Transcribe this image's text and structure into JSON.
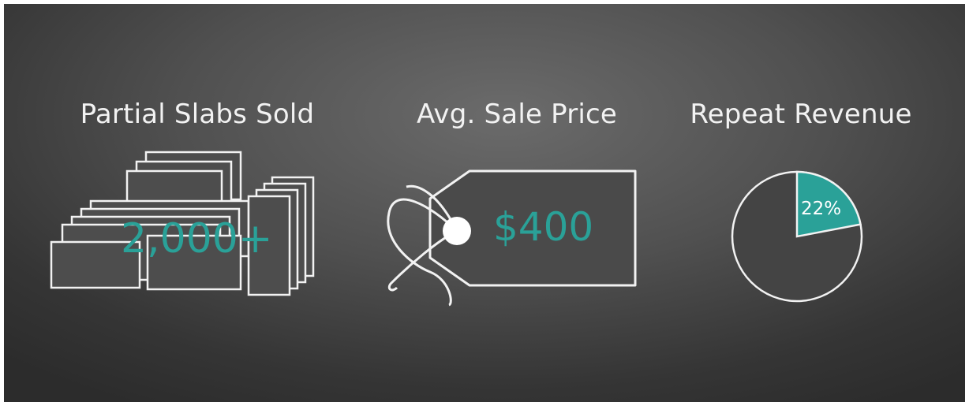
{
  "stats": [
    {
      "heading": "Partial Slabs Sold",
      "value": "2,000+",
      "icon": "stacked-slabs-icon"
    },
    {
      "heading": "Avg. Sale Price",
      "value": "$400",
      "icon": "price-tag-icon"
    },
    {
      "heading": "Repeat Revenue",
      "value": "22%",
      "icon": "pie-chart-icon",
      "share_percent": 22
    }
  ],
  "colors": {
    "accent": "#2aa198",
    "text": "#f2f2f2",
    "line": "#f5f5f5",
    "background": "#4a4a4a"
  }
}
